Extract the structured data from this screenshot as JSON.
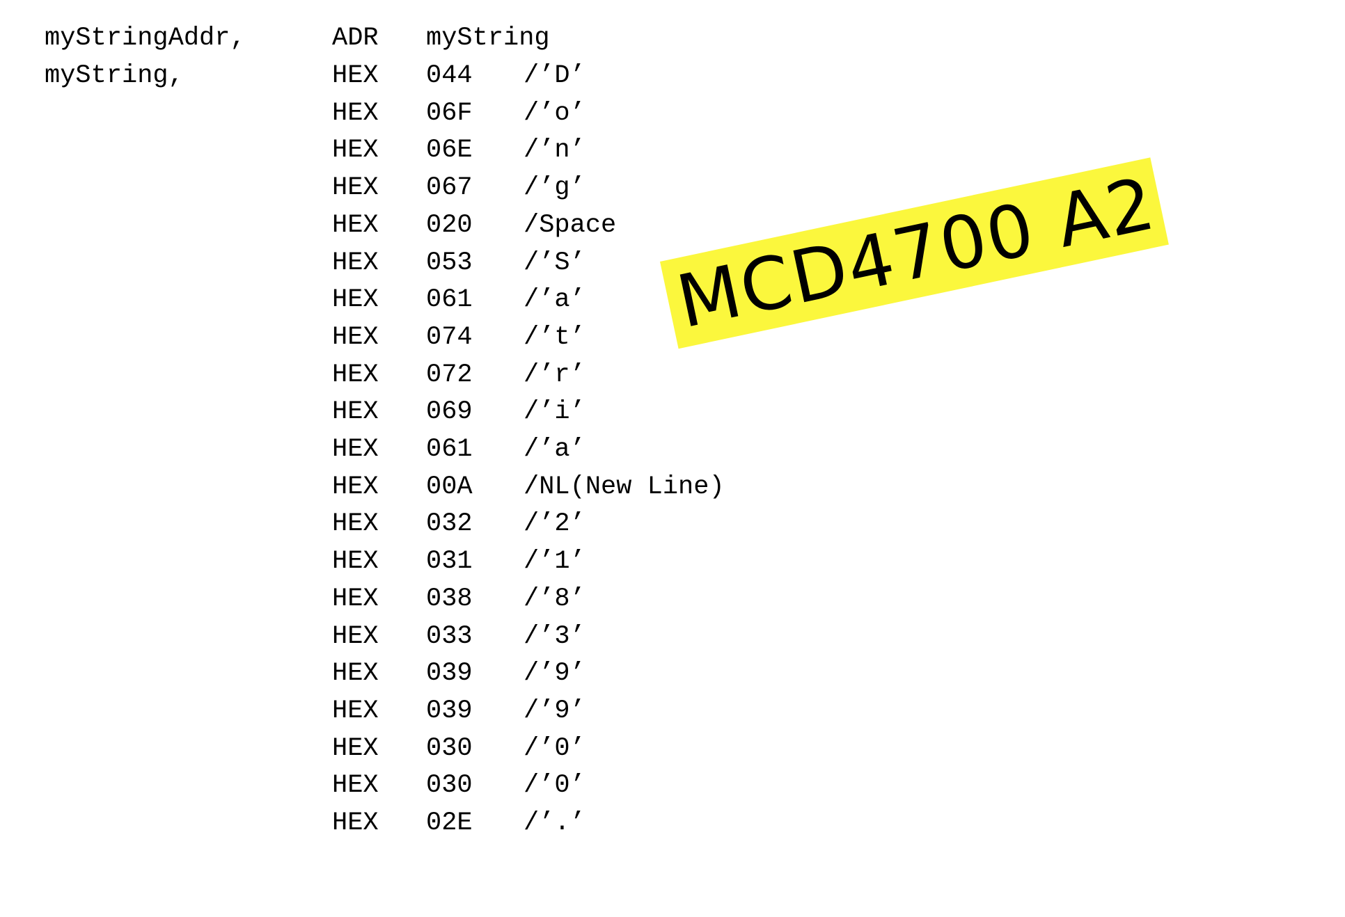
{
  "header_line": {
    "label": "myStringAddr,",
    "opcode": "ADR",
    "operand": "myString"
  },
  "rows": [
    {
      "label": "myString,",
      "opcode": "HEX",
      "operand": "044",
      "comment": "/’D’"
    },
    {
      "label": "",
      "opcode": "HEX",
      "operand": "06F",
      "comment": "/’o’"
    },
    {
      "label": "",
      "opcode": "HEX",
      "operand": "06E",
      "comment": "/’n’"
    },
    {
      "label": "",
      "opcode": "HEX",
      "operand": "067",
      "comment": "/’g’"
    },
    {
      "label": "",
      "opcode": "HEX",
      "operand": "020",
      "comment": "/Space"
    },
    {
      "label": "",
      "opcode": "HEX",
      "operand": "053",
      "comment": "/’S’"
    },
    {
      "label": "",
      "opcode": "HEX",
      "operand": "061",
      "comment": "/’a’"
    },
    {
      "label": "",
      "opcode": "HEX",
      "operand": "074",
      "comment": "/’t’"
    },
    {
      "label": "",
      "opcode": "HEX",
      "operand": "072",
      "comment": "/’r’"
    },
    {
      "label": "",
      "opcode": "HEX",
      "operand": "069",
      "comment": "/’i’"
    },
    {
      "label": "",
      "opcode": "HEX",
      "operand": "061",
      "comment": "/’a’"
    },
    {
      "label": "",
      "opcode": "HEX",
      "operand": "00A",
      "comment": "/NL(New Line)"
    },
    {
      "label": "",
      "opcode": "HEX",
      "operand": "032",
      "comment": "/’2’"
    },
    {
      "label": "",
      "opcode": "HEX",
      "operand": "031",
      "comment": "/’1’"
    },
    {
      "label": "",
      "opcode": "HEX",
      "operand": "038",
      "comment": "/’8’"
    },
    {
      "label": "",
      "opcode": "HEX",
      "operand": "033",
      "comment": "/’3’"
    },
    {
      "label": "",
      "opcode": "HEX",
      "operand": "039",
      "comment": "/’9’"
    },
    {
      "label": "",
      "opcode": "HEX",
      "operand": "039",
      "comment": "/’9’"
    },
    {
      "label": "",
      "opcode": "HEX",
      "operand": "030",
      "comment": "/’0’"
    },
    {
      "label": "",
      "opcode": "HEX",
      "operand": "030",
      "comment": "/’0’"
    },
    {
      "label": "",
      "opcode": "HEX",
      "operand": "02E",
      "comment": "/’.’"
    }
  ],
  "stamp": {
    "text": "MCD4700 A2",
    "background_color": "#fbf73d"
  }
}
